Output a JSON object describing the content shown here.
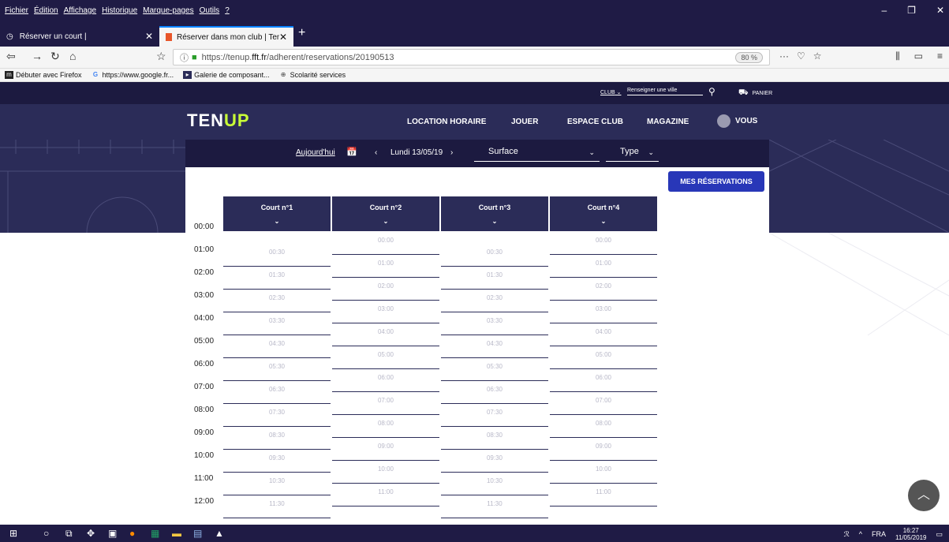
{
  "browser": {
    "menu": [
      "Fichier",
      "Édition",
      "Affichage",
      "Historique",
      "Marque-pages",
      "Outils",
      "?"
    ],
    "tabs": [
      {
        "label": "Réserver un court |"
      },
      {
        "label": "Réserver dans mon club | Ten'U"
      }
    ],
    "url_prefix": "https://tenup.",
    "url_host": "fft.fr",
    "url_path": "/adherent/reservations/20190513",
    "zoom": "80 %",
    "bookmarks": [
      {
        "label": "Débuter avec Firefox"
      },
      {
        "label": "https://www.google.fr..."
      },
      {
        "label": "Galerie de composant..."
      },
      {
        "label": "Scolarité services"
      }
    ]
  },
  "site": {
    "club_label": "CLUB",
    "city_placeholder": "Renseigner une ville",
    "panier": "PANIER",
    "logo_ten": "TEN",
    "logo_up": "UP",
    "nav": [
      "LOCATION HORAIRE",
      "JOUER",
      "ESPACE CLUB",
      "MAGAZINE"
    ],
    "vous": "VOUS"
  },
  "filters": {
    "today": "Aujourd'hui",
    "date": "Lundi 13/05/19",
    "surface": "Surface",
    "type": "Type"
  },
  "reservations": {
    "my_reservations": "MES RÉSERVATIONS",
    "hours": [
      "00:00",
      "01:00",
      "02:00",
      "03:00",
      "04:00",
      "05:00",
      "06:00",
      "07:00",
      "08:00",
      "09:00",
      "10:00",
      "11:00",
      "12:00"
    ],
    "courts": [
      "Court n°1",
      "Court n°2",
      "Court n°3",
      "Court n°4"
    ],
    "slots_odd": [
      "00:30",
      "01:30",
      "02:30",
      "03:30",
      "04:30",
      "05:30",
      "06:30",
      "07:30",
      "08:30",
      "09:30",
      "10:30",
      "11:30"
    ],
    "slots_even": [
      "00:00",
      "01:00",
      "02:00",
      "03:00",
      "04:00",
      "05:00",
      "06:00",
      "07:00",
      "08:00",
      "09:00",
      "10:00",
      "11:00",
      "12:00"
    ]
  },
  "taskbar": {
    "lang": "FRA",
    "time": "16:27",
    "date": "11/05/2019"
  }
}
